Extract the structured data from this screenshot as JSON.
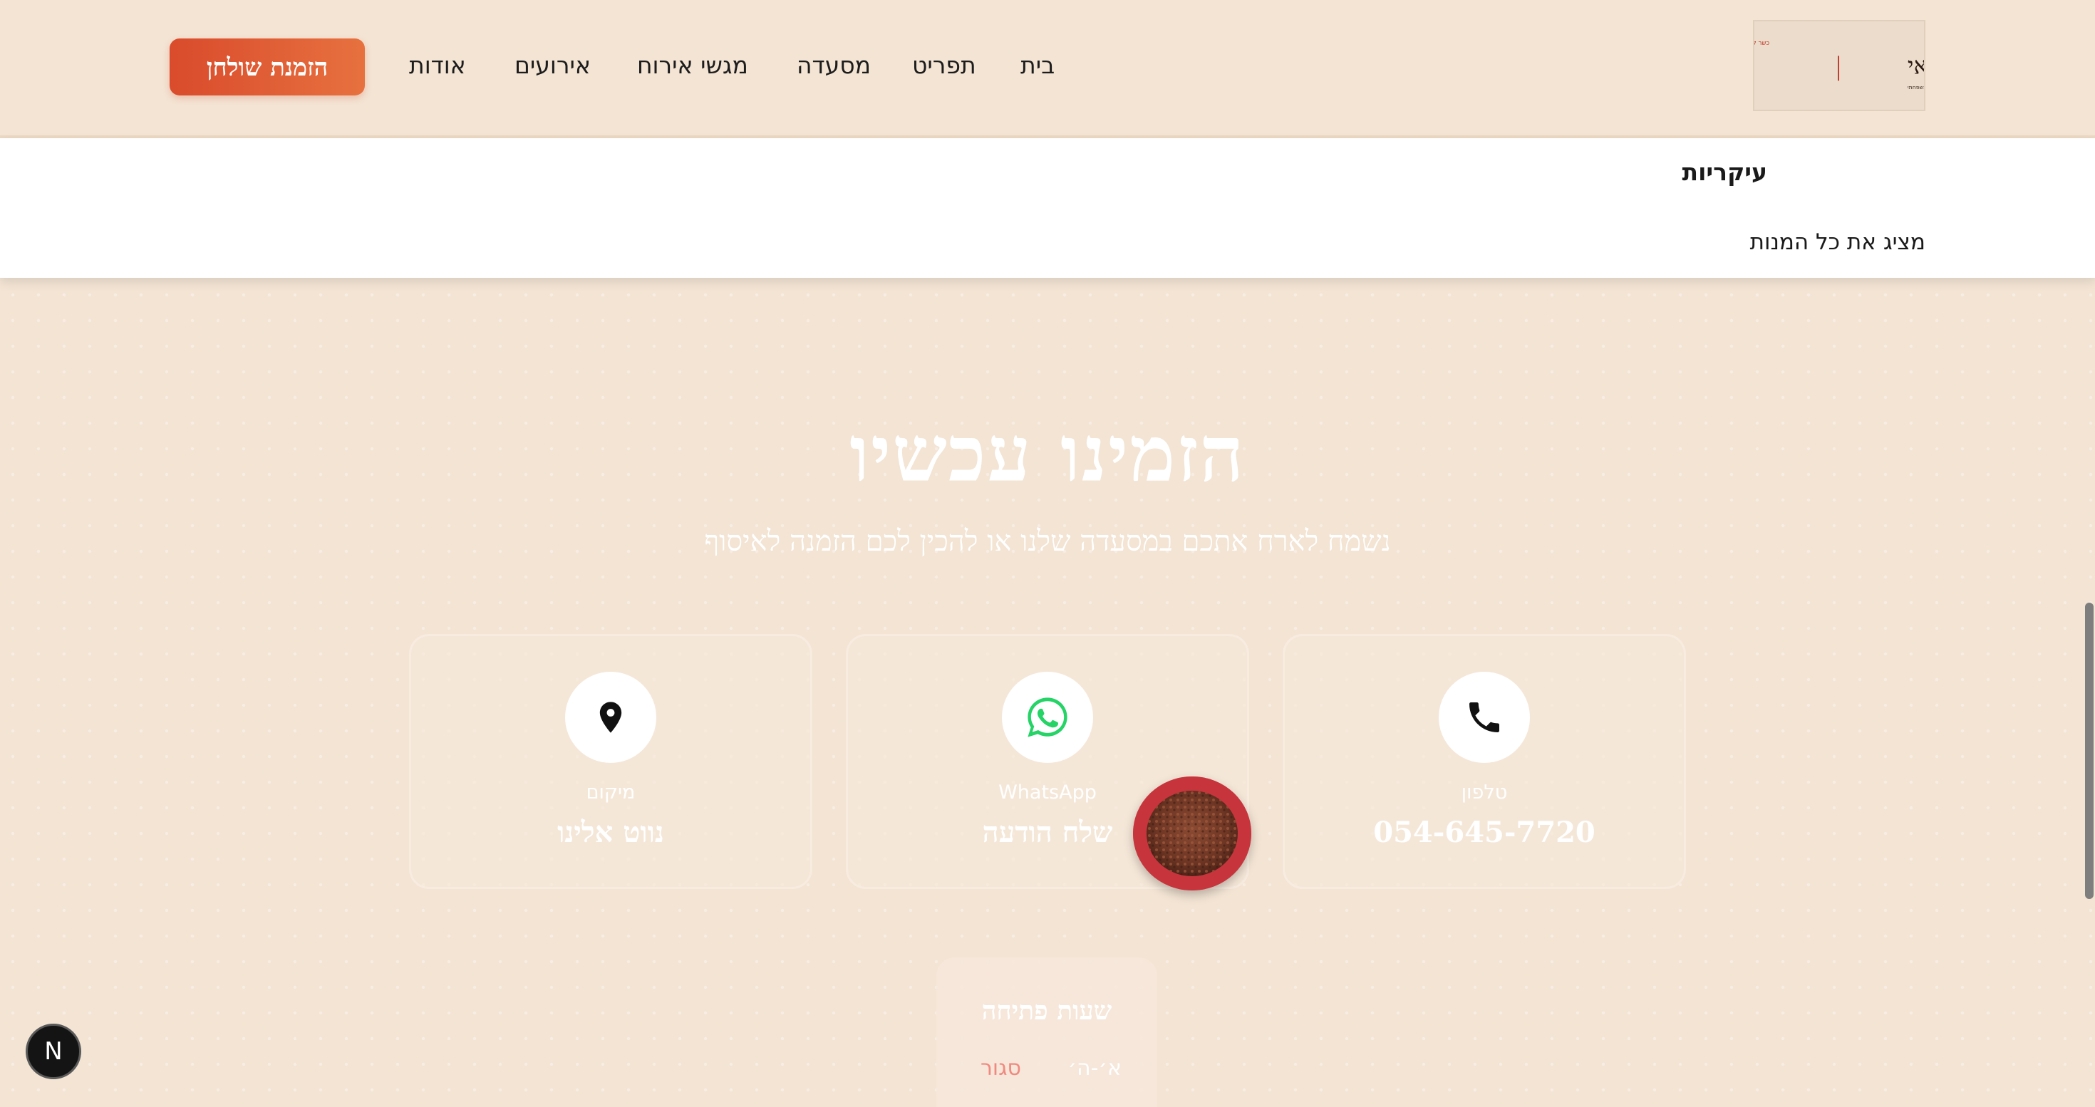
{
  "header": {
    "logo": {
      "tagline_top": "כשר למהדרין",
      "brand": "בביס מרוקאי",
      "tagline_bottom": "אוכל מרוקאי, ביתי, אמיתי ומשפחתי"
    },
    "nav": {
      "home": "בית",
      "menu": "תפריט",
      "restaurant": "מסעדה",
      "catering_trays": "מגשי אירוח",
      "events": "אירועים",
      "about": "אודות"
    },
    "reserve_button": "הזמנת שולחן"
  },
  "dropdown": {
    "main": "עיקריות",
    "show_all": "מציג את כל המנות"
  },
  "hero": {
    "title": "הזמינו עכשיו",
    "subtitle": "נשמח לארח אתכם במסעדה שלנו או להכין לכם הזמנה לאיסוף"
  },
  "contact_cards": {
    "phone": {
      "label": "טלפון",
      "value": "054-645-7720",
      "icon": "phone-icon"
    },
    "whatsapp": {
      "label": "WhatsApp",
      "value": "שלח הודעה",
      "icon": "whatsapp-icon"
    },
    "location": {
      "label": "מיקום",
      "value": "נווט אלינו",
      "icon": "location-pin-icon"
    }
  },
  "opening_hours": {
    "title": "שעות פתיחה",
    "day": "א׳-ה׳",
    "status": "סגור"
  },
  "dev_badge": "N",
  "colors": {
    "background": "#f3e4d4",
    "accent_start": "#d94b2c",
    "accent_end": "#e7713f",
    "whatsapp_green": "#25d366",
    "closed_red": "#f08a80"
  }
}
